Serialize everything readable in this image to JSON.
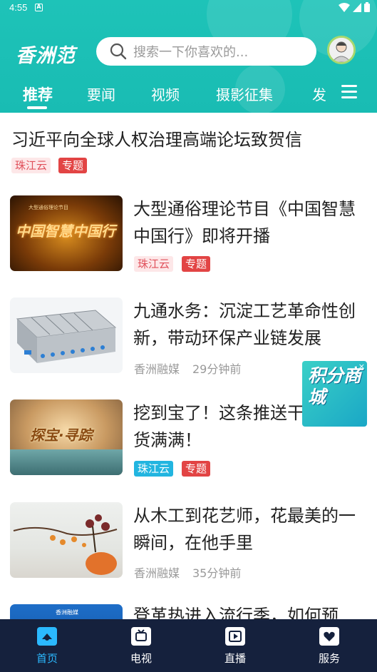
{
  "status_bar": {
    "time": "4:55",
    "notification_icon": "A"
  },
  "header": {
    "logo": "香洲范",
    "search_placeholder": "搜索一下你喜欢的...",
    "accent_color": "#1ec3b8"
  },
  "tabs": [
    {
      "label": "推荐",
      "active": true
    },
    {
      "label": "要闻"
    },
    {
      "label": "视频"
    },
    {
      "label": "摄影征集"
    },
    {
      "label": "发"
    }
  ],
  "feed": {
    "headline": {
      "title": "习近平向全球人权治理高端论坛致贺信",
      "tags": [
        "珠江云",
        "专题"
      ]
    },
    "items": [
      {
        "title": "大型通俗理论节目《中国智慧中国行》即将开播",
        "tags": [
          "珠江云",
          "专题"
        ],
        "thumb_text": "中国智慧中国行",
        "thumb_small": "大型通俗理论节目"
      },
      {
        "title": "九通水务：沉淀工艺革命性创新，带动环保产业链发展",
        "source": "香洲融媒",
        "time": "29分钟前"
      },
      {
        "title": "挖到宝了！这条推送干货满满！",
        "tags": [
          "珠江云",
          "专题"
        ],
        "thumb_text": "探宝·寻踪"
      },
      {
        "title": "从木工到花艺师，花最美的一瞬间，在他手里",
        "source": "香洲融媒",
        "time": "35分钟前"
      },
      {
        "title": "登革热进入流行季，如何预",
        "thumb_text": "香洲融媒"
      }
    ]
  },
  "floating_ad": {
    "text": "积分商城",
    "close": "×"
  },
  "bottom_nav": [
    {
      "label": "首页",
      "icon": "home-icon",
      "active": true
    },
    {
      "label": "电视",
      "icon": "tv-icon"
    },
    {
      "label": "直播",
      "icon": "live-icon"
    },
    {
      "label": "服务",
      "icon": "service-icon"
    }
  ]
}
